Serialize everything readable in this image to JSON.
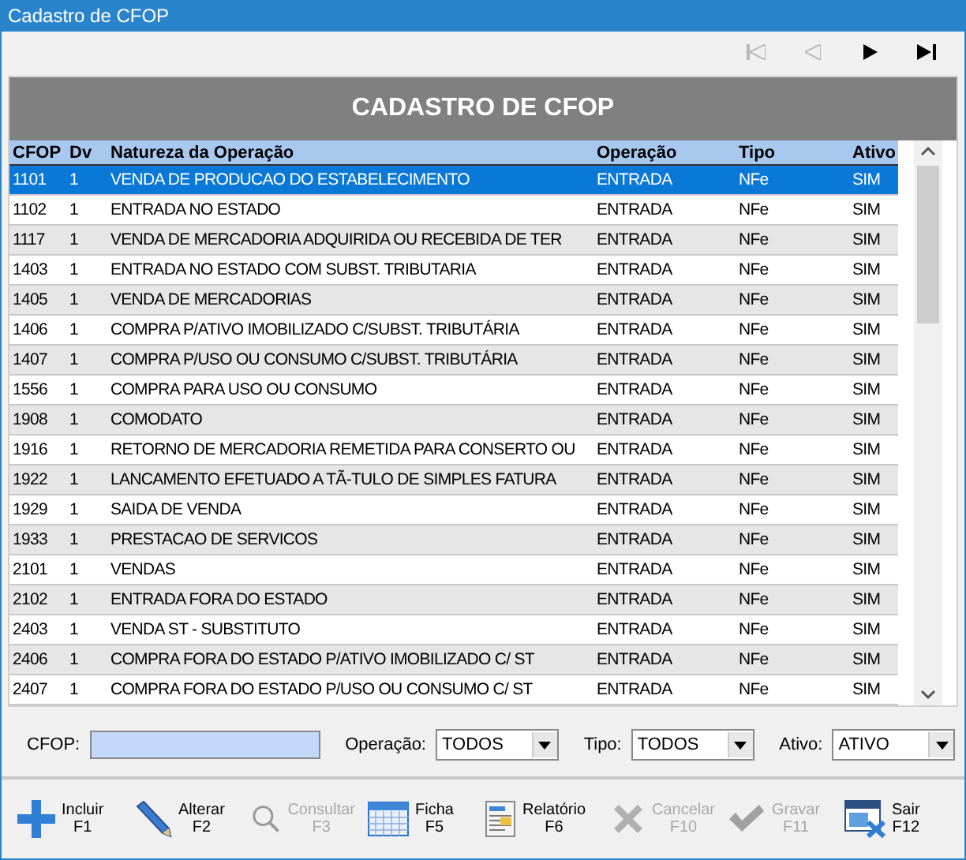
{
  "window": {
    "title": "Cadastro de CFOP"
  },
  "nav_buttons": [
    {
      "kind": "first",
      "disabled": true
    },
    {
      "kind": "prev",
      "disabled": true
    },
    {
      "kind": "next",
      "disabled": false
    },
    {
      "kind": "last",
      "disabled": false
    }
  ],
  "grid": {
    "title": "CADASTRO DE CFOP",
    "columns": [
      "CFOP",
      "Dv",
      "Natureza da Operação",
      "Operação",
      "Tipo",
      "Ativo"
    ],
    "rows": [
      {
        "cells": [
          "1101",
          "1",
          "VENDA DE PRODUCAO DO ESTABELECIMENTO",
          "ENTRADA",
          "NFe",
          "SIM"
        ],
        "selected": true
      },
      {
        "cells": [
          "1102",
          "1",
          "ENTRADA NO ESTADO",
          "ENTRADA",
          "NFe",
          "SIM"
        ],
        "selected": false
      },
      {
        "cells": [
          "1117",
          "1",
          "VENDA DE MERCADORIA ADQUIRIDA OU RECEBIDA DE TER",
          "ENTRADA",
          "NFe",
          "SIM"
        ],
        "selected": false
      },
      {
        "cells": [
          "1403",
          "1",
          "ENTRADA NO ESTADO COM SUBST. TRIBUTARIA",
          "ENTRADA",
          "NFe",
          "SIM"
        ],
        "selected": false
      },
      {
        "cells": [
          "1405",
          "1",
          "VENDA DE MERCADORIAS",
          "ENTRADA",
          "NFe",
          "SIM"
        ],
        "selected": false
      },
      {
        "cells": [
          "1406",
          "1",
          "COMPRA P/ATIVO IMOBILIZADO C/SUBST. TRIBUTÁRIA",
          "ENTRADA",
          "NFe",
          "SIM"
        ],
        "selected": false
      },
      {
        "cells": [
          "1407",
          "1",
          "COMPRA P/USO OU CONSUMO C/SUBST. TRIBUTÁRIA",
          "ENTRADA",
          "NFe",
          "SIM"
        ],
        "selected": false
      },
      {
        "cells": [
          "1556",
          "1",
          "COMPRA PARA USO OU CONSUMO",
          "ENTRADA",
          "NFe",
          "SIM"
        ],
        "selected": false
      },
      {
        "cells": [
          "1908",
          "1",
          "COMODATO",
          "ENTRADA",
          "NFe",
          "SIM"
        ],
        "selected": false
      },
      {
        "cells": [
          "1916",
          "1",
          "RETORNO DE MERCADORIA REMETIDA PARA CONSERTO OU",
          "ENTRADA",
          "NFe",
          "SIM"
        ],
        "selected": false
      },
      {
        "cells": [
          "1922",
          "1",
          "LANCAMENTO EFETUADO A TÃ-TULO DE SIMPLES FATURA",
          "ENTRADA",
          "NFe",
          "SIM"
        ],
        "selected": false
      },
      {
        "cells": [
          "1929",
          "1",
          "SAIDA DE VENDA",
          "ENTRADA",
          "NFe",
          "SIM"
        ],
        "selected": false
      },
      {
        "cells": [
          "1933",
          "1",
          "PRESTACAO DE SERVICOS",
          "ENTRADA",
          "NFe",
          "SIM"
        ],
        "selected": false
      },
      {
        "cells": [
          "2101",
          "1",
          "VENDAS",
          "ENTRADA",
          "NFe",
          "SIM"
        ],
        "selected": false
      },
      {
        "cells": [
          "2102",
          "1",
          "ENTRADA FORA DO ESTADO",
          "ENTRADA",
          "NFe",
          "SIM"
        ],
        "selected": false
      },
      {
        "cells": [
          "2403",
          "1",
          "VENDA ST - SUBSTITUTO",
          "ENTRADA",
          "NFe",
          "SIM"
        ],
        "selected": false
      },
      {
        "cells": [
          "2406",
          "1",
          "COMPRA FORA DO ESTADO P/ATIVO IMOBILIZADO C/ ST",
          "ENTRADA",
          "NFe",
          "SIM"
        ],
        "selected": false
      },
      {
        "cells": [
          "2407",
          "1",
          "COMPRA FORA DO ESTADO P/USO OU CONSUMO C/ ST",
          "ENTRADA",
          "NFe",
          "SIM"
        ],
        "selected": false
      }
    ]
  },
  "filters": [
    {
      "kind": "text",
      "label": "CFOP:"
    },
    {
      "kind": "select",
      "label": "Operação:",
      "value": "TODOS"
    },
    {
      "kind": "select",
      "label": "Tipo:",
      "value": "TODOS"
    },
    {
      "kind": "select",
      "label": "Ativo:",
      "value": "ATIVO"
    }
  ],
  "toolbar": [
    {
      "kind": "add",
      "label": "Incluir",
      "key": "F1",
      "disabled": false
    },
    {
      "kind": "edit",
      "label": "Alterar",
      "key": "F2",
      "disabled": false
    },
    {
      "kind": "search",
      "label": "Consultar",
      "key": "F3",
      "disabled": true
    },
    {
      "kind": "calendar",
      "label": "Ficha",
      "key": "F5",
      "disabled": false
    },
    {
      "kind": "report",
      "label": "Relatório",
      "key": "F6",
      "disabled": false
    },
    {
      "kind": "cancel",
      "label": "Cancelar",
      "key": "F10",
      "disabled": true
    },
    {
      "kind": "save",
      "label": "Gravar",
      "key": "F11",
      "disabled": true
    },
    {
      "kind": "exit",
      "label": "Sair",
      "key": "F12",
      "disabled": false
    }
  ]
}
